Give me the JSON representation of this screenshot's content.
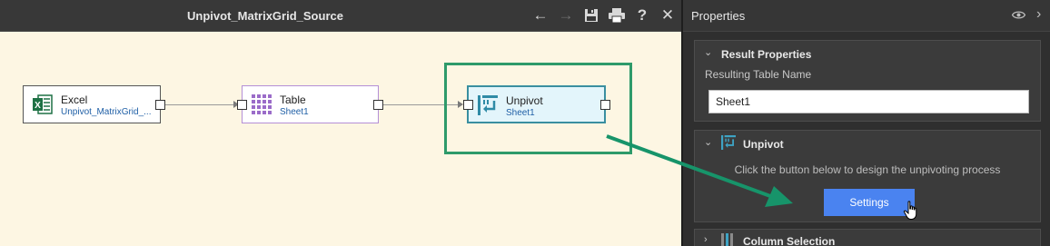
{
  "canvas": {
    "title": "Unpivot_MatrixGrid_Source",
    "toolbar": {
      "back_icon": "←",
      "forward_icon": "→",
      "save_icon": "save-icon",
      "print_icon": "print-icon",
      "help_label": "?",
      "close_label": "✕"
    },
    "nodes": [
      {
        "name": "Excel",
        "sub": "Unpivot_MatrixGrid_...",
        "icon": "excel-icon"
      },
      {
        "name": "Table",
        "sub": "Sheet1",
        "icon": "table-grid-icon"
      },
      {
        "name": "Unpivot",
        "sub": "Sheet1",
        "icon": "unpivot-icon"
      }
    ],
    "colors": {
      "canvas_bg": "#fdf6e3",
      "highlight": "#2e9a6a",
      "table_node_border": "#b48fd6",
      "unpivot_node_bg": "#e3f5fb",
      "unpivot_node_border": "#3a8fa0"
    }
  },
  "properties": {
    "title": "Properties",
    "eye_icon": "eye-icon",
    "expand_icon": "›",
    "result_section": {
      "title": "Result Properties",
      "field_label": "Resulting Table Name",
      "field_value": "Sheet1"
    },
    "unpivot_section": {
      "title": "Unpivot",
      "info": "Click the button below to design the unpivoting process",
      "button_label": "Settings"
    },
    "column_section": {
      "title": "Column Selection"
    },
    "colors": {
      "button": "#4a83f0"
    }
  }
}
